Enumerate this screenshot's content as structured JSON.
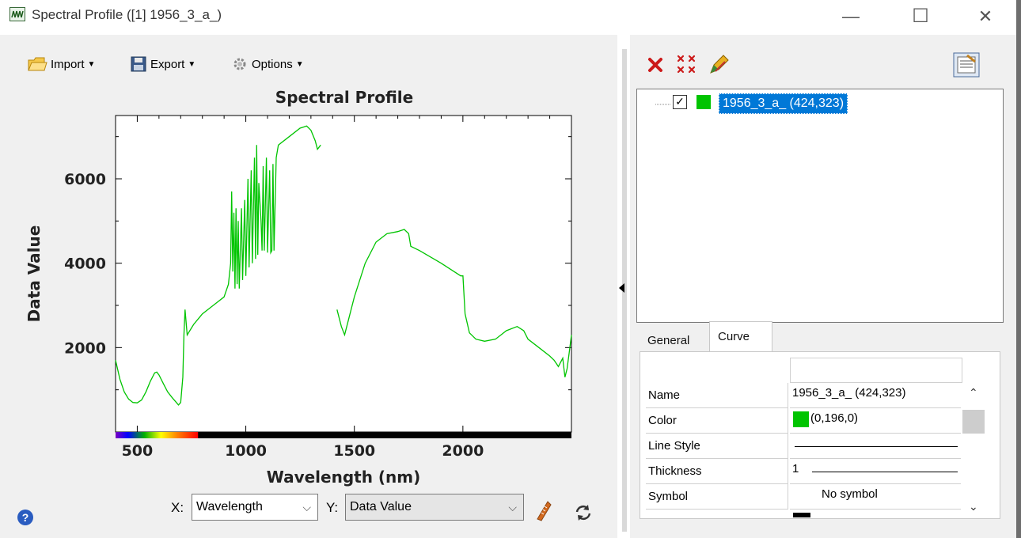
{
  "window": {
    "title": "Spectral Profile ([1] 1956_3_a_)",
    "minimize": "—",
    "maximize": "☐",
    "close": "✕"
  },
  "toolbar": {
    "import_label": "Import",
    "export_label": "Export",
    "options_label": "Options"
  },
  "chart_data": {
    "type": "line",
    "title": "Spectral Profile",
    "xlabel": "Wavelength (nm)",
    "ylabel": "Data Value",
    "xlim": [
      400,
      2500
    ],
    "ylim": [
      0,
      7500
    ],
    "x_ticks": [
      "500",
      "1000",
      "1500",
      "2000"
    ],
    "x_tick_values": [
      500,
      1000,
      1500,
      2000
    ],
    "y_ticks": [
      "2000",
      "4000",
      "6000"
    ],
    "y_tick_values": [
      2000,
      4000,
      6000
    ],
    "grid": false,
    "series": [
      {
        "name": "1956_3_a_ (424,323)",
        "color": "#00c400",
        "segments": [
          [
            [
              400,
              1700
            ],
            [
              420,
              1250
            ],
            [
              440,
              950
            ],
            [
              460,
              780
            ],
            [
              480,
              700
            ],
            [
              500,
              690
            ],
            [
              520,
              760
            ],
            [
              540,
              950
            ],
            [
              560,
              1200
            ],
            [
              580,
              1400
            ],
            [
              590,
              1420
            ],
            [
              600,
              1350
            ],
            [
              620,
              1150
            ],
            [
              640,
              950
            ],
            [
              660,
              820
            ],
            [
              680,
              700
            ],
            [
              690,
              640
            ],
            [
              700,
              700
            ],
            [
              710,
              1300
            ],
            [
              715,
              2300
            ],
            [
              720,
              2900
            ],
            [
              730,
              2300
            ],
            [
              760,
              2550
            ],
            [
              800,
              2800
            ],
            [
              850,
              3000
            ],
            [
              900,
              3200
            ],
            [
              920,
              3500
            ],
            [
              930,
              4000
            ],
            [
              935,
              5700
            ],
            [
              940,
              3800
            ],
            [
              945,
              5200
            ],
            [
              950,
              3400
            ],
            [
              955,
              5300
            ],
            [
              960,
              3500
            ],
            [
              965,
              5000
            ],
            [
              970,
              3400
            ],
            [
              980,
              5300
            ],
            [
              985,
              3600
            ],
            [
              995,
              5500
            ],
            [
              1000,
              3700
            ],
            [
              1010,
              6000
            ],
            [
              1015,
              3900
            ],
            [
              1025,
              6200
            ],
            [
              1030,
              4000
            ],
            [
              1040,
              6500
            ],
            [
              1045,
              4100
            ],
            [
              1050,
              6800
            ],
            [
              1055,
              4200
            ],
            [
              1060,
              5900
            ],
            [
              1070,
              5000
            ],
            [
              1075,
              4300
            ],
            [
              1080,
              6300
            ],
            [
              1085,
              4300
            ],
            [
              1095,
              6500
            ],
            [
              1100,
              4250
            ],
            [
              1110,
              6200
            ],
            [
              1115,
              4250
            ],
            [
              1120,
              4300
            ],
            [
              1125,
              6350
            ],
            [
              1130,
              4300
            ],
            [
              1140,
              6500
            ],
            [
              1150,
              6800
            ],
            [
              1200,
              7000
            ],
            [
              1250,
              7200
            ],
            [
              1280,
              7250
            ],
            [
              1300,
              7150
            ],
            [
              1320,
              6900
            ],
            [
              1330,
              6700
            ],
            [
              1345,
              6800
            ]
          ],
          [
            [
              1420,
              2900
            ],
            [
              1440,
              2500
            ],
            [
              1455,
              2300
            ],
            [
              1470,
              2600
            ],
            [
              1500,
              3200
            ],
            [
              1550,
              4000
            ],
            [
              1600,
              4500
            ],
            [
              1650,
              4700
            ],
            [
              1700,
              4750
            ],
            [
              1730,
              4800
            ],
            [
              1750,
              4700
            ],
            [
              1760,
              4400
            ],
            [
              1800,
              4300
            ],
            [
              1900,
              4000
            ],
            [
              1990,
              3700
            ],
            [
              2000,
              3700
            ],
            [
              2010,
              2800
            ],
            [
              2030,
              2350
            ],
            [
              2060,
              2200
            ],
            [
              2100,
              2150
            ],
            [
              2150,
              2200
            ],
            [
              2200,
              2400
            ],
            [
              2250,
              2500
            ],
            [
              2280,
              2400
            ],
            [
              2300,
              2200
            ],
            [
              2350,
              2000
            ],
            [
              2400,
              1800
            ],
            [
              2420,
              1700
            ],
            [
              2440,
              1550
            ],
            [
              2460,
              1750
            ],
            [
              2470,
              1300
            ],
            [
              2480,
              1500
            ],
            [
              2490,
              1900
            ],
            [
              2500,
              2300
            ]
          ]
        ]
      }
    ]
  },
  "right_toolbar": {
    "delete_icon": "delete-icon",
    "delete_all_icon": "delete-all-icon",
    "edit_icon": "edit-icon",
    "properties_icon": "properties-icon"
  },
  "tree": {
    "item_label": "1956_3_a_ (424,323)",
    "item_color": "#00c400",
    "checked": true
  },
  "tabs": {
    "general": "General",
    "curve": "Curve"
  },
  "properties": [
    {
      "name": "Name",
      "value": "1956_3_a_ (424,323)"
    },
    {
      "name": "Color",
      "value": "(0,196,0)"
    },
    {
      "name": "Line Style",
      "value": ""
    },
    {
      "name": "Thickness",
      "value": "1"
    },
    {
      "name": "Symbol",
      "value": "No symbol"
    }
  ],
  "bottom": {
    "x_label": "X:",
    "x_value": "Wavelength",
    "y_label": "Y:",
    "y_value": "Data Value",
    "help_icon": "?"
  }
}
